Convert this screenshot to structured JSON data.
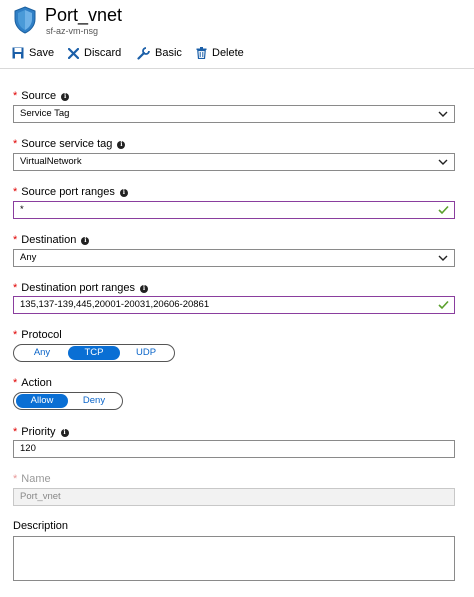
{
  "header": {
    "title": "Port_vnet",
    "subtitle": "sf-az-vm-nsg"
  },
  "toolbar": {
    "save": "Save",
    "discard": "Discard",
    "basic": "Basic",
    "delete": "Delete"
  },
  "form": {
    "source": {
      "label": "Source",
      "value": "Service Tag"
    },
    "source_service_tag": {
      "label": "Source service tag",
      "value": "VirtualNetwork"
    },
    "source_port_ranges": {
      "label": "Source port ranges",
      "value": "*"
    },
    "destination": {
      "label": "Destination",
      "value": "Any"
    },
    "destination_port_ranges": {
      "label": "Destination port ranges",
      "value": "135,137-139,445,20001-20031,20606-20861"
    },
    "protocol": {
      "label": "Protocol",
      "options": [
        "Any",
        "TCP",
        "UDP"
      ],
      "selected": "TCP"
    },
    "action": {
      "label": "Action",
      "options": [
        "Allow",
        "Deny"
      ],
      "selected": "Allow"
    },
    "priority": {
      "label": "Priority",
      "value": "120"
    },
    "name": {
      "label": "Name",
      "value": "Port_vnet"
    },
    "description": {
      "label": "Description",
      "value": ""
    }
  },
  "colors": {
    "accent": "#0a6fd4",
    "required": "#e00000",
    "valid_border": "#8a3e9e",
    "check": "#5aa02c"
  }
}
